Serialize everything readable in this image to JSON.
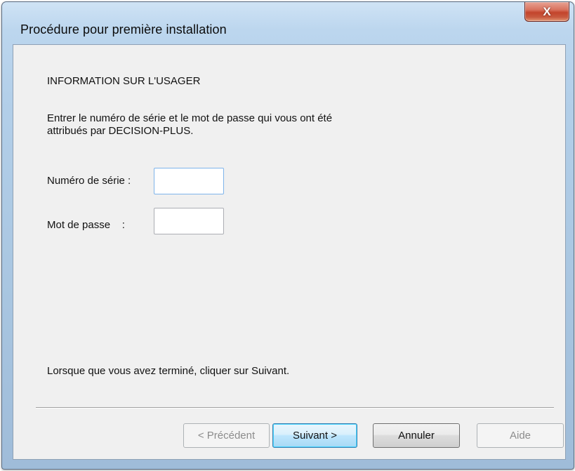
{
  "window": {
    "title": "Procédure pour première installation",
    "close_label": "X"
  },
  "section": {
    "heading": "INFORMATION SUR L'USAGER",
    "description_line1": "Entrer le numéro de série et le mot de passe qui vous ont été",
    "description_line2": "attribués par DECISION-PLUS."
  },
  "form": {
    "serial_label": "Numéro de série :",
    "serial_value": "",
    "password_label": "Mot de passe    :",
    "password_value": ""
  },
  "footer": {
    "message": "Lorsque que vous avez terminé, cliquer sur Suivant."
  },
  "buttons": {
    "previous": "< Précédent",
    "next": "Suivant >",
    "cancel": "Annuler",
    "help": "Aide"
  }
}
